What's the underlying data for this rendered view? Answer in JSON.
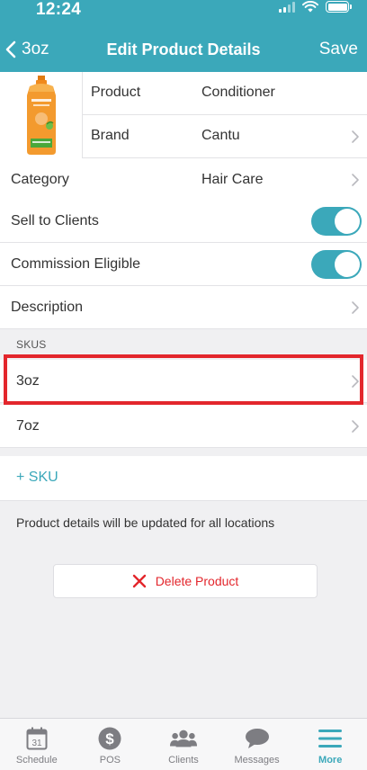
{
  "status_bar": {
    "time": "12:24"
  },
  "nav": {
    "back_label": "3oz",
    "title": "Edit Product Details",
    "save_label": "Save"
  },
  "product": {
    "image_alt": "conditioner-bottle",
    "rows": [
      {
        "label": "Product",
        "value": "Conditioner"
      },
      {
        "label": "Brand",
        "value": "Cantu"
      }
    ],
    "image_text": "CANTU"
  },
  "settings": {
    "category": {
      "label": "Category",
      "value": "Hair Care"
    },
    "sell_to_clients": {
      "label": "Sell to Clients",
      "on": true
    },
    "commission_eligible": {
      "label": "Commission Eligible",
      "on": true
    },
    "description": {
      "label": "Description"
    }
  },
  "skus": {
    "header": "SKUS",
    "items": [
      {
        "label": "3oz"
      },
      {
        "label": "7oz"
      }
    ],
    "add_label": "+ SKU"
  },
  "note": "Product details will be updated for all locations",
  "delete_label": "Delete Product",
  "tabs": [
    {
      "label": "Schedule",
      "icon": "calendar-icon",
      "badge": "31"
    },
    {
      "label": "POS",
      "icon": "dollar-icon",
      "badge": "$"
    },
    {
      "label": "Clients",
      "icon": "clients-icon"
    },
    {
      "label": "Messages",
      "icon": "messages-icon"
    },
    {
      "label": "More",
      "icon": "menu-icon",
      "active": true
    }
  ],
  "colors": {
    "accent": "#3ba8ba",
    "danger": "#e3262c",
    "highlight": "#e3262c"
  }
}
